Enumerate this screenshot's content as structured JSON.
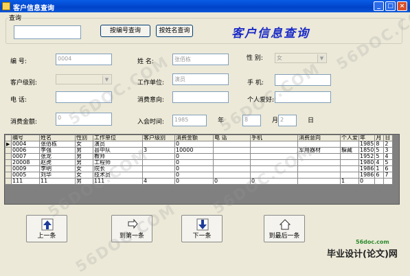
{
  "window": {
    "title": "客户信息查询",
    "buttons": [
      "_",
      "□",
      "×"
    ]
  },
  "search": {
    "group_label": "查询",
    "input_value": "",
    "by_id_button": "按编号查询",
    "by_name_button": "按姓名查询",
    "banner": "客户信息查询"
  },
  "form": {
    "id_label": "编      号:",
    "id_value": "0004",
    "name_label": "姓      名:",
    "name_value": "张佰栋",
    "gender_label": "性      别:",
    "gender_value": "女",
    "level_label": "客户级别:",
    "level_value": "",
    "work_label": "工作单位:",
    "work_value": "演员",
    "phone_label": "手      机:",
    "phone_value": "",
    "tel_label": "电      话:",
    "tel_value": "",
    "intent_label": "消费意向:",
    "intent_value": "",
    "hobby_label": "个人爱好:",
    "hobby_value": "",
    "amount_label": "消费金额:",
    "amount_value": "0",
    "join_label": "入会时间:",
    "year_value": "1985",
    "year_label": "年",
    "month_value": "8",
    "month_label": "月",
    "day_value": "2",
    "day_label": "日"
  },
  "grid": {
    "columns": [
      "编号",
      "姓名",
      "性别",
      "工作单位",
      "客户级别",
      "消费金额",
      "电    话",
      "手机",
      "消费意向",
      "个人爱",
      "年",
      "月",
      "日"
    ],
    "rows": [
      [
        "0004",
        "张佰栋",
        "女",
        "演员",
        "",
        "0",
        "",
        "",
        "",
        "",
        "1985",
        "8",
        "2"
      ],
      [
        "0006",
        "李强",
        "男",
        "县中队",
        "3",
        "10000",
        "",
        "",
        "军用器材",
        "躲藏",
        "1850",
        "5",
        "3"
      ],
      [
        "0007",
        "张龙",
        "男",
        "教师",
        "",
        "0",
        "",
        "",
        "",
        "",
        "1952",
        "5",
        "4"
      ],
      [
        "20008",
        "赵虎",
        "男",
        "工程师",
        "",
        "0",
        "",
        "",
        "",
        "",
        "1980",
        "4",
        "5"
      ],
      [
        "0009",
        "李明",
        "女",
        "院长",
        "",
        "0",
        "",
        "",
        "",
        "",
        "1986",
        "1",
        "6"
      ],
      [
        "0005",
        "刘华",
        "女",
        "技术员",
        "",
        "0",
        "",
        "",
        "",
        "",
        "1986",
        "6",
        "7"
      ],
      [
        "111",
        "11",
        "男",
        "111",
        "4",
        "0",
        "0",
        "0",
        "",
        "1",
        "0",
        "",
        ""
      ]
    ],
    "current_row_marker": "▶"
  },
  "nav": {
    "prev": "上一条",
    "first": "到第一条",
    "next": "下一条",
    "last": "到最后一条"
  },
  "watermarks": [
    "56DOC.COM",
    "56DOC.COM",
    "56DOC.COM",
    "56DOC.COM",
    "56DOC.COM",
    "56DOC.COM"
  ],
  "brand": {
    "url": "56doc.com",
    "text": "毕业设计(论文)网"
  },
  "colors": {
    "titlebar": "#0043c9",
    "banner": "#1c2cc6",
    "background": "#ece9d8"
  }
}
